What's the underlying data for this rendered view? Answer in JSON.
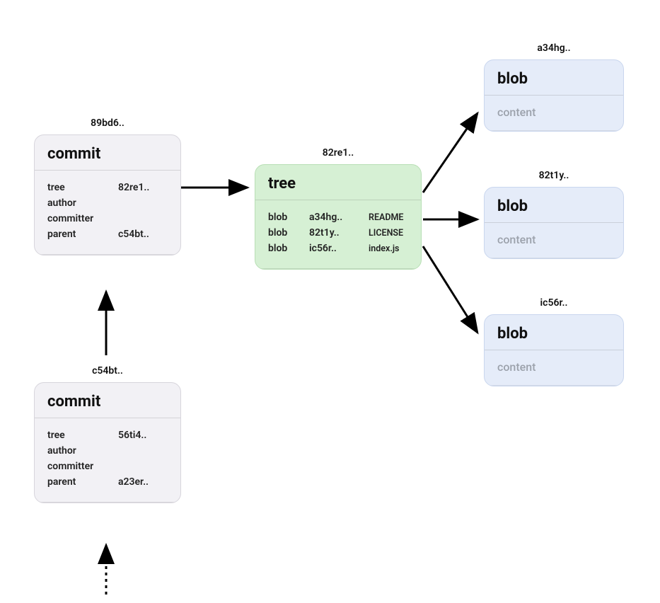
{
  "commit1": {
    "hash": "89bd6..",
    "title": "commit",
    "rows": [
      {
        "key": "tree",
        "val": "82re1.."
      },
      {
        "key": "author",
        "val": ""
      },
      {
        "key": "committer",
        "val": ""
      },
      {
        "key": "parent",
        "val": "c54bt.."
      }
    ]
  },
  "commit2": {
    "hash": "c54bt..",
    "title": "commit",
    "rows": [
      {
        "key": "tree",
        "val": "56ti4.."
      },
      {
        "key": "author",
        "val": ""
      },
      {
        "key": "committer",
        "val": ""
      },
      {
        "key": "parent",
        "val": "a23er.."
      }
    ]
  },
  "tree": {
    "hash": "82re1..",
    "title": "tree",
    "rows": [
      {
        "type": "blob",
        "hash": "a34hg..",
        "name": "README"
      },
      {
        "type": "blob",
        "hash": "82t1y..",
        "name": "LICENSE"
      },
      {
        "type": "blob",
        "hash": "ic56r..",
        "name": "index.js"
      }
    ]
  },
  "blob1": {
    "hash": "a34hg..",
    "title": "blob",
    "content": "content"
  },
  "blob2": {
    "hash": "82t1y..",
    "title": "blob",
    "content": "content"
  },
  "blob3": {
    "hash": "ic56r..",
    "title": "blob",
    "content": "content"
  }
}
